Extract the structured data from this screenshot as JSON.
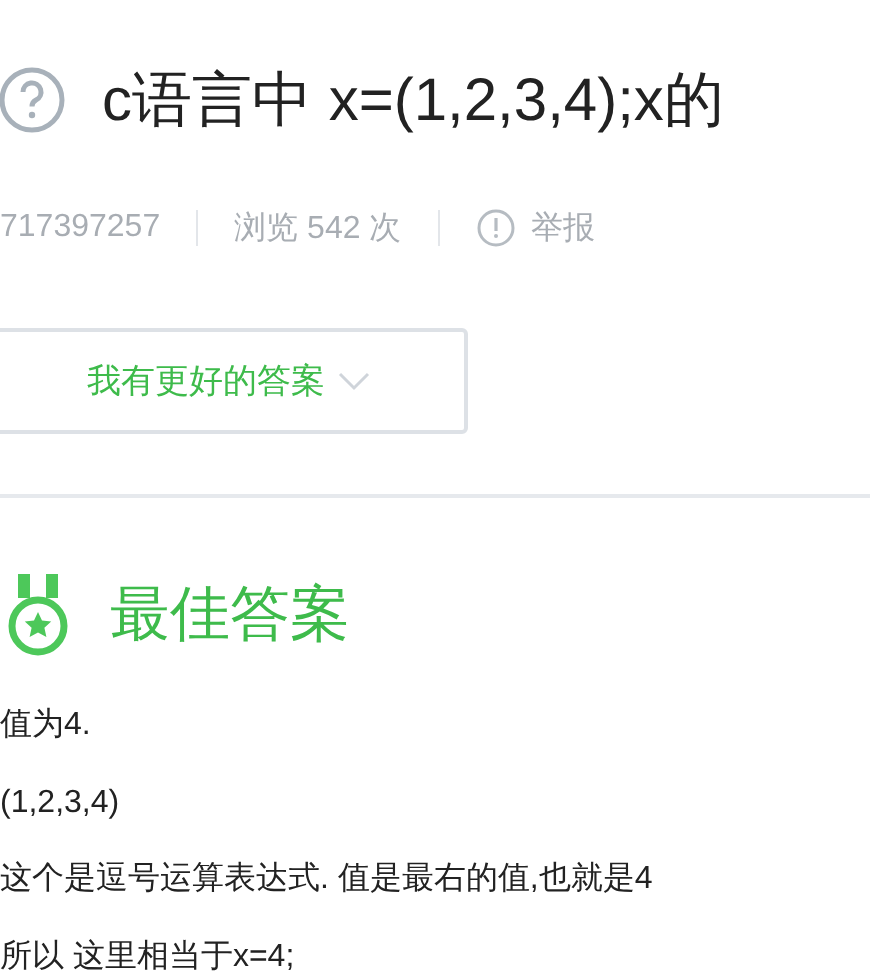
{
  "question": {
    "title": "c语言中 x=(1,2,3,4);x的",
    "author": "717397257",
    "views": "浏览 542 次",
    "report": "举报"
  },
  "better_answer_button": {
    "label": "我有更好的答案"
  },
  "best_answer": {
    "heading": "最佳答案",
    "lines": [
      "值为4.",
      "(1,2,3,4)",
      "这个是逗号运算表达式. 值是最右的值,也就是4",
      "所以 这里相当于x=4;"
    ]
  }
}
